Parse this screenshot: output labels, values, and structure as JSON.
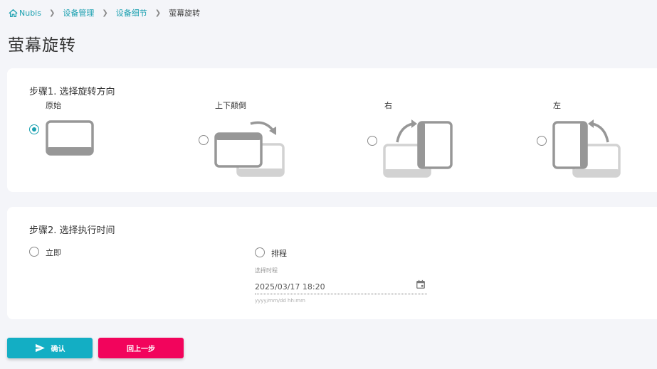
{
  "breadcrumb": {
    "items": [
      "Nubis",
      "设备管理",
      "设备细节"
    ],
    "current": "萤幕旋转"
  },
  "page_title": "萤幕旋转",
  "step1": {
    "title": "步骤1. 选择旋转方向",
    "options": [
      {
        "label": "原始",
        "checked": true,
        "icon": "landscape-original-icon"
      },
      {
        "label": "上下颠倒",
        "checked": false,
        "icon": "rotate-flip-icon"
      },
      {
        "label": "右",
        "checked": false,
        "icon": "rotate-right-icon"
      },
      {
        "label": "左",
        "checked": false,
        "icon": "rotate-left-icon"
      }
    ]
  },
  "step2": {
    "title": "步骤2. 选择执行时间",
    "immediate_label": "立即",
    "schedule_label": "排程",
    "schedule_field_label": "选择时程",
    "schedule_value": "2025/03/17 18:20",
    "schedule_hint": "yyyy/mm/dd hh:mm"
  },
  "buttons": {
    "confirm": "确认",
    "back": "回上一步"
  },
  "colors": {
    "accent": "#13aec4",
    "danger": "#f2045c"
  }
}
